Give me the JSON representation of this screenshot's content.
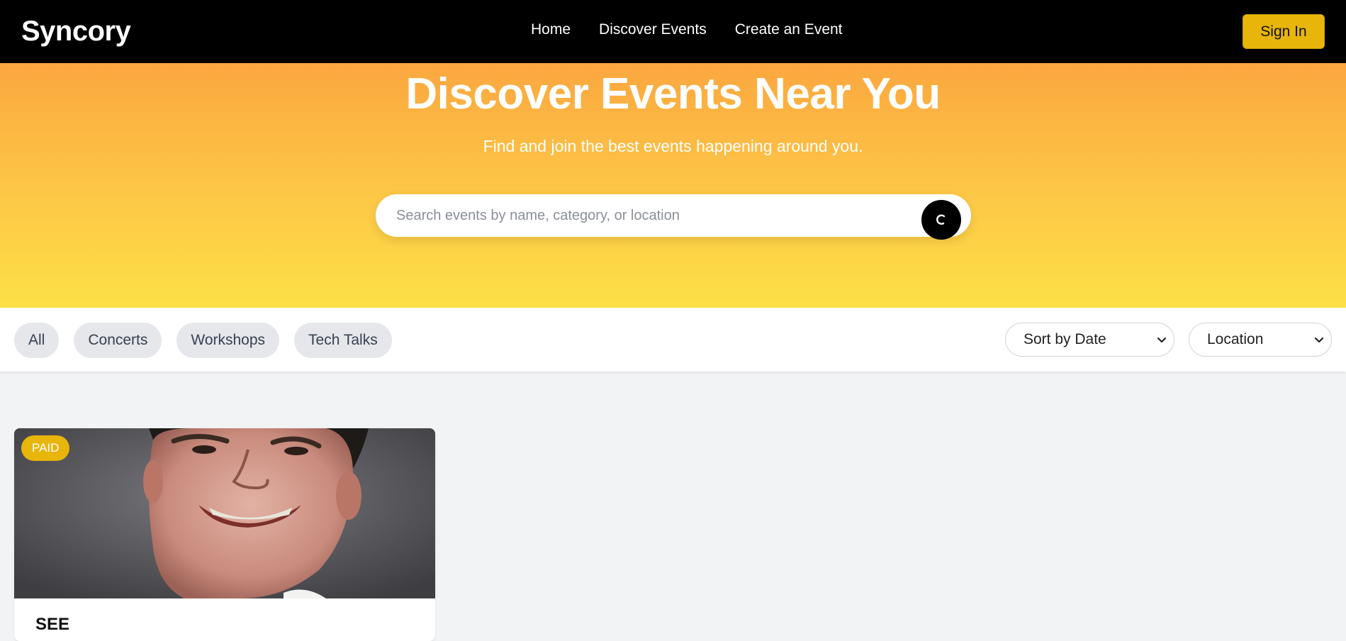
{
  "header": {
    "brand": "Syncory",
    "nav": [
      {
        "label": "Home"
      },
      {
        "label": "Discover Events"
      },
      {
        "label": "Create an Event"
      }
    ],
    "signin_label": "Sign In"
  },
  "hero": {
    "title": "Discover Events Near You",
    "subtitle": "Find and join the best events happening around you.",
    "search_placeholder": "Search events by name, category, or location",
    "search_value": "",
    "search_icon": "loading-spinner-icon"
  },
  "filters": {
    "chips": [
      {
        "label": "All"
      },
      {
        "label": "Concerts"
      },
      {
        "label": "Workshops"
      },
      {
        "label": "Tech Talks"
      }
    ],
    "sort_selected": "Sort by Date",
    "location_selected": "Location"
  },
  "events": [
    {
      "badge": "PAID",
      "title": "SEE",
      "image": "portrait-photo"
    }
  ],
  "colors": {
    "nav_bg": "#000000",
    "accent": "#e8b50a",
    "hero_top": "#fba73f",
    "hero_bottom": "#fde047",
    "page_bg": "#f2f3f5"
  }
}
